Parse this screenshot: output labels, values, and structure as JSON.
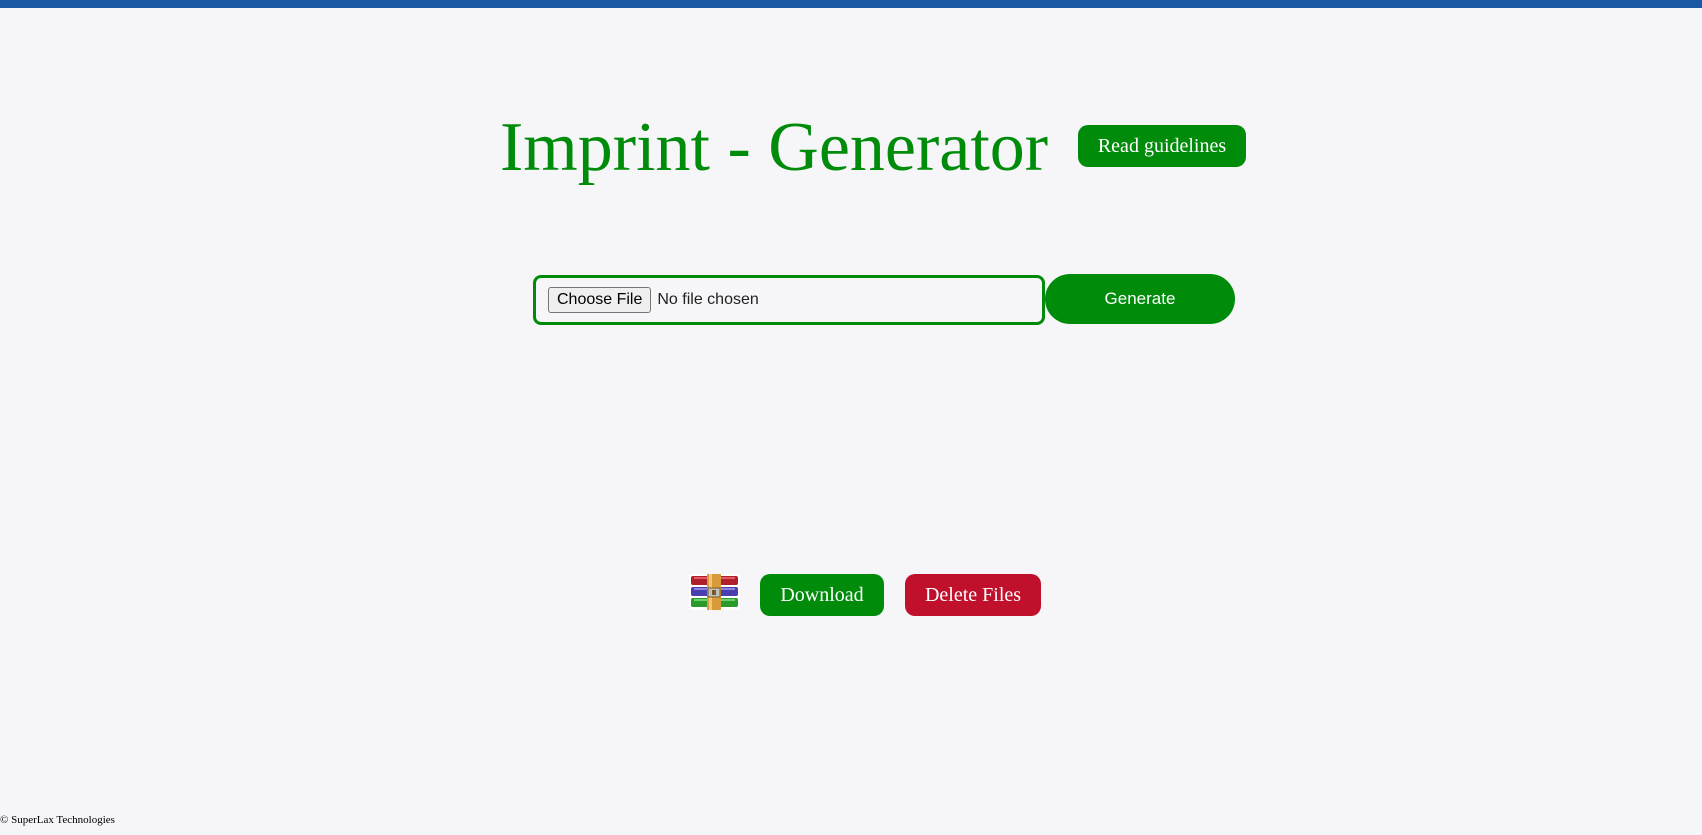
{
  "header": {
    "title": "Imprint - Generator",
    "guidelines_label": "Read guidelines"
  },
  "upload": {
    "choose_file_label": "Choose File",
    "file_status": "No file chosen",
    "generate_label": "Generate"
  },
  "actions": {
    "archive_icon": "archive-icon",
    "download_label": "Download",
    "delete_label": "Delete Files"
  },
  "footer": {
    "copyright": "© SuperLax Technologies"
  },
  "colors": {
    "top_bar": "#1a58a3",
    "accent_green": "#008c0a",
    "danger_red": "#c0102c",
    "background": "#f6f6f9"
  }
}
